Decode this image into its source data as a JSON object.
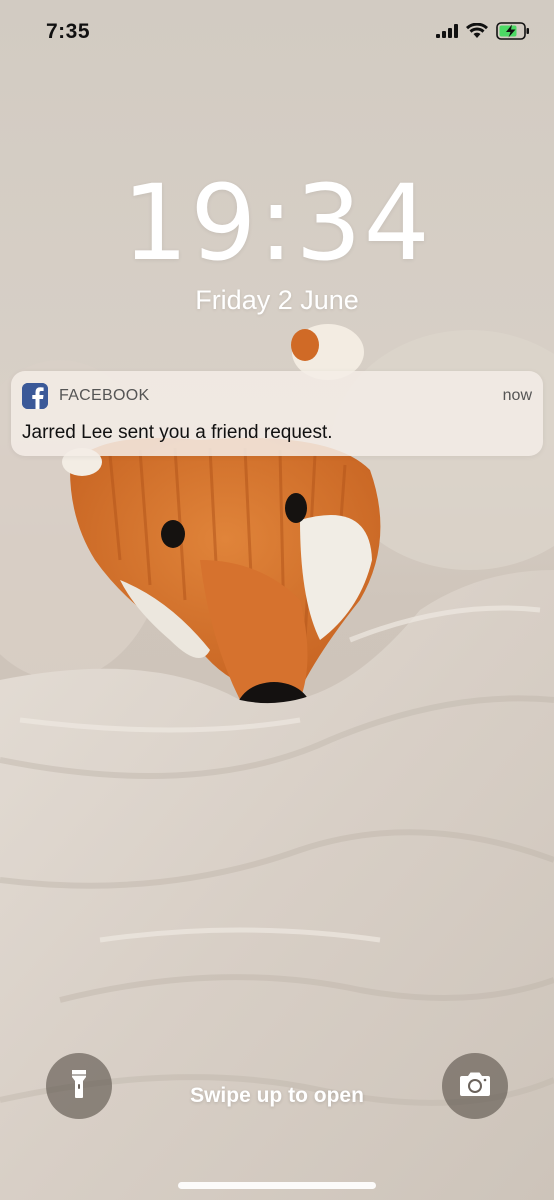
{
  "status_bar": {
    "time": "7:35",
    "signal_icon": "cellular-signal-icon",
    "wifi_icon": "wifi-icon",
    "battery_icon": "battery-charging-icon",
    "battery_color": "#4cd964"
  },
  "lock_screen": {
    "clock": "19:34",
    "date": "Friday 2 June"
  },
  "notification": {
    "app_icon": "facebook-icon",
    "app_color": "#3b5998",
    "app_name": "FACEBOOK",
    "time": "now",
    "message": "Jarred Lee sent you a friend request."
  },
  "bottom": {
    "flashlight_icon": "flashlight-icon",
    "camera_icon": "camera-icon",
    "swipe_text": "Swipe up to open"
  }
}
